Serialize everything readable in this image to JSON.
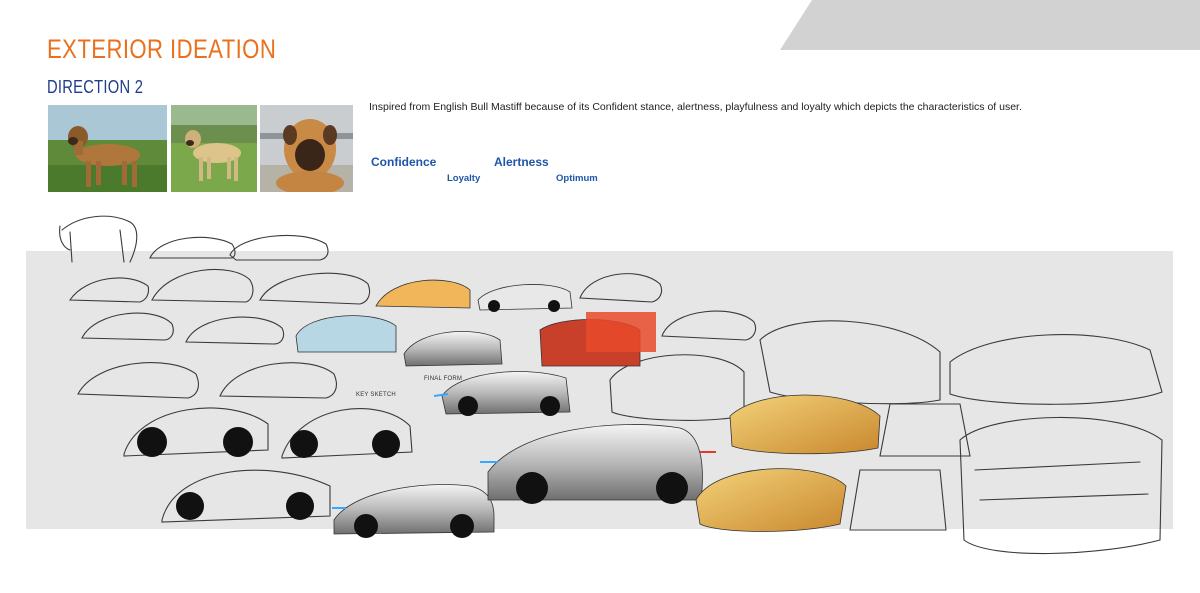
{
  "header": {
    "title": "EXTERIOR IDEATION",
    "subtitle": "DIRECTION 2"
  },
  "description": "Inspired from English Bull Mastiff because of its Confident stance, alertness, playfulness and loyalty which depicts the characteristics of user.",
  "keywords": {
    "confidence": "Confidence",
    "alertness": "Alertness",
    "loyalty": "Loyalty",
    "optimum": "Optimum"
  },
  "sketch_labels": {
    "key_sketch": "KEY SKETCH",
    "final_form": "FINAL FORM"
  },
  "colors": {
    "accent_orange": "#e8701e",
    "navy": "#1f3c8c",
    "keyword_blue": "#1f55a8",
    "band_gray": "#e6e6e6",
    "corner_gray": "#d2d2d2"
  }
}
